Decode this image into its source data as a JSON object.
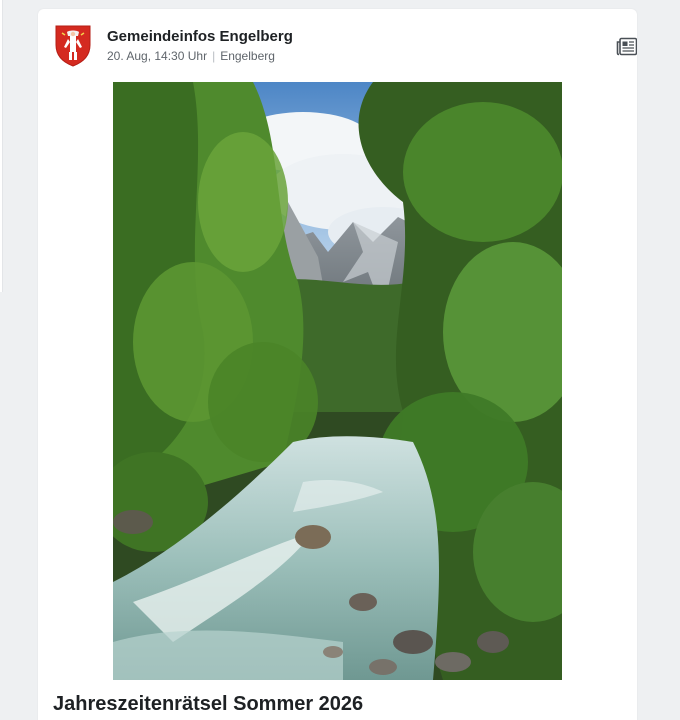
{
  "post": {
    "author": "Gemeindeinfos Engelberg",
    "timestamp": "20. Aug, 14:30 Uhr",
    "location": "Engelberg",
    "title": "Jahreszeitenrätsel Sommer 2026"
  },
  "icons": {
    "crest": "coat-of-arms-icon",
    "type": "newspaper-icon"
  },
  "colors": {
    "crest_red": "#d42a20",
    "text_primary": "#1e2124",
    "text_secondary": "#5f656b",
    "background": "#eef0f2"
  }
}
